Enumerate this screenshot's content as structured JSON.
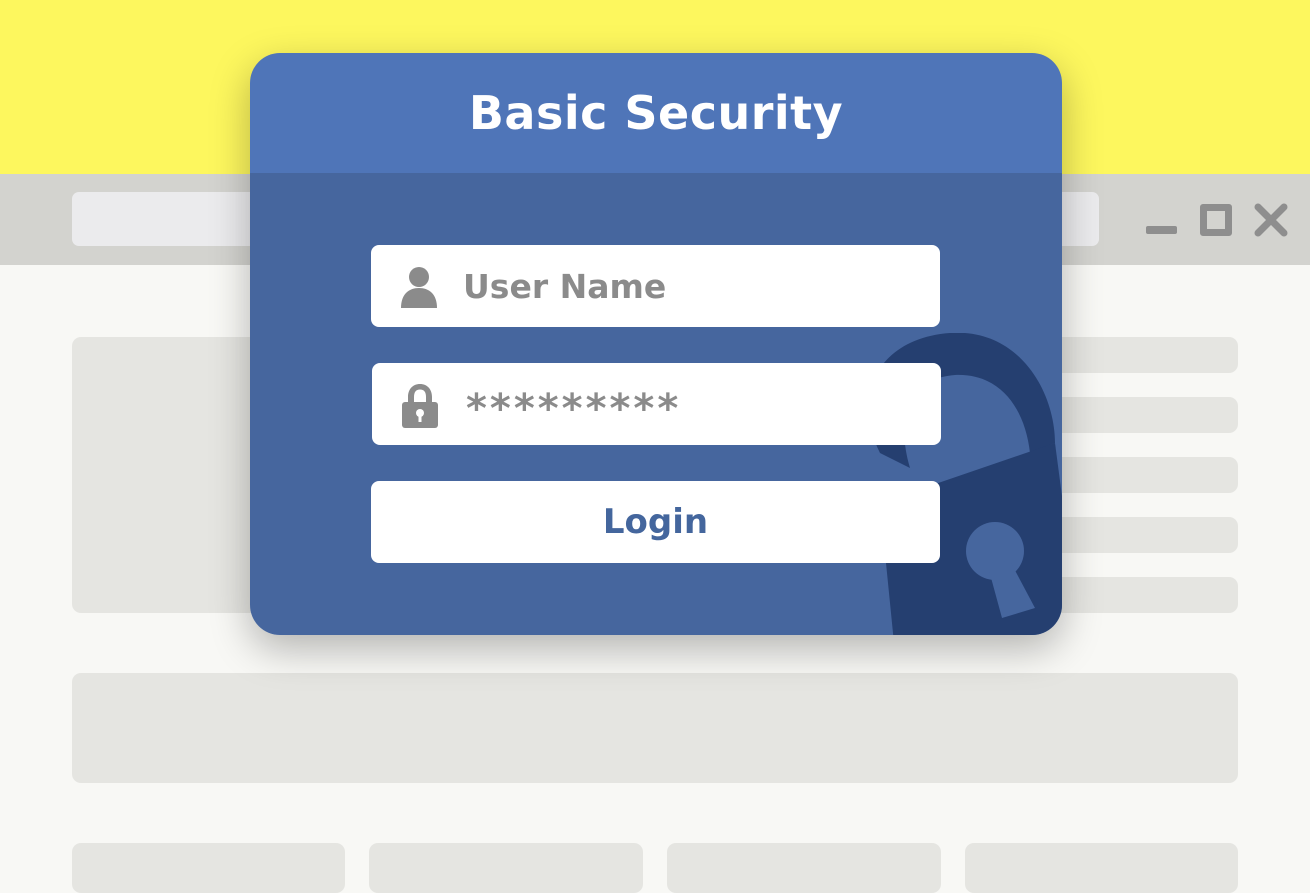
{
  "colors": {
    "yellow_band": "#fdf75e",
    "browser_bar": "#d3d3cf",
    "address_bar": "#ebebed",
    "window_controls": "#8e8e8e",
    "page_background": "#f8f8f5",
    "placeholder_block": "#e5e5e1",
    "dialog_header": "#4f75b8",
    "dialog_body": "#46669e",
    "padlock_watermark": "#253f70",
    "field_text": "#8b8b8b",
    "login_text": "#44669d"
  },
  "browser": {
    "minimize_icon": "minimize-icon",
    "maximize_icon": "maximize-icon",
    "close_icon": "close-icon"
  },
  "dialog": {
    "title": "Basic Security",
    "username": {
      "placeholder": "User Name",
      "value": "",
      "icon": "user-icon"
    },
    "password": {
      "masked_value": "*********",
      "icon": "lock-icon"
    },
    "login_label": "Login",
    "watermark_icon": "padlock-icon"
  }
}
